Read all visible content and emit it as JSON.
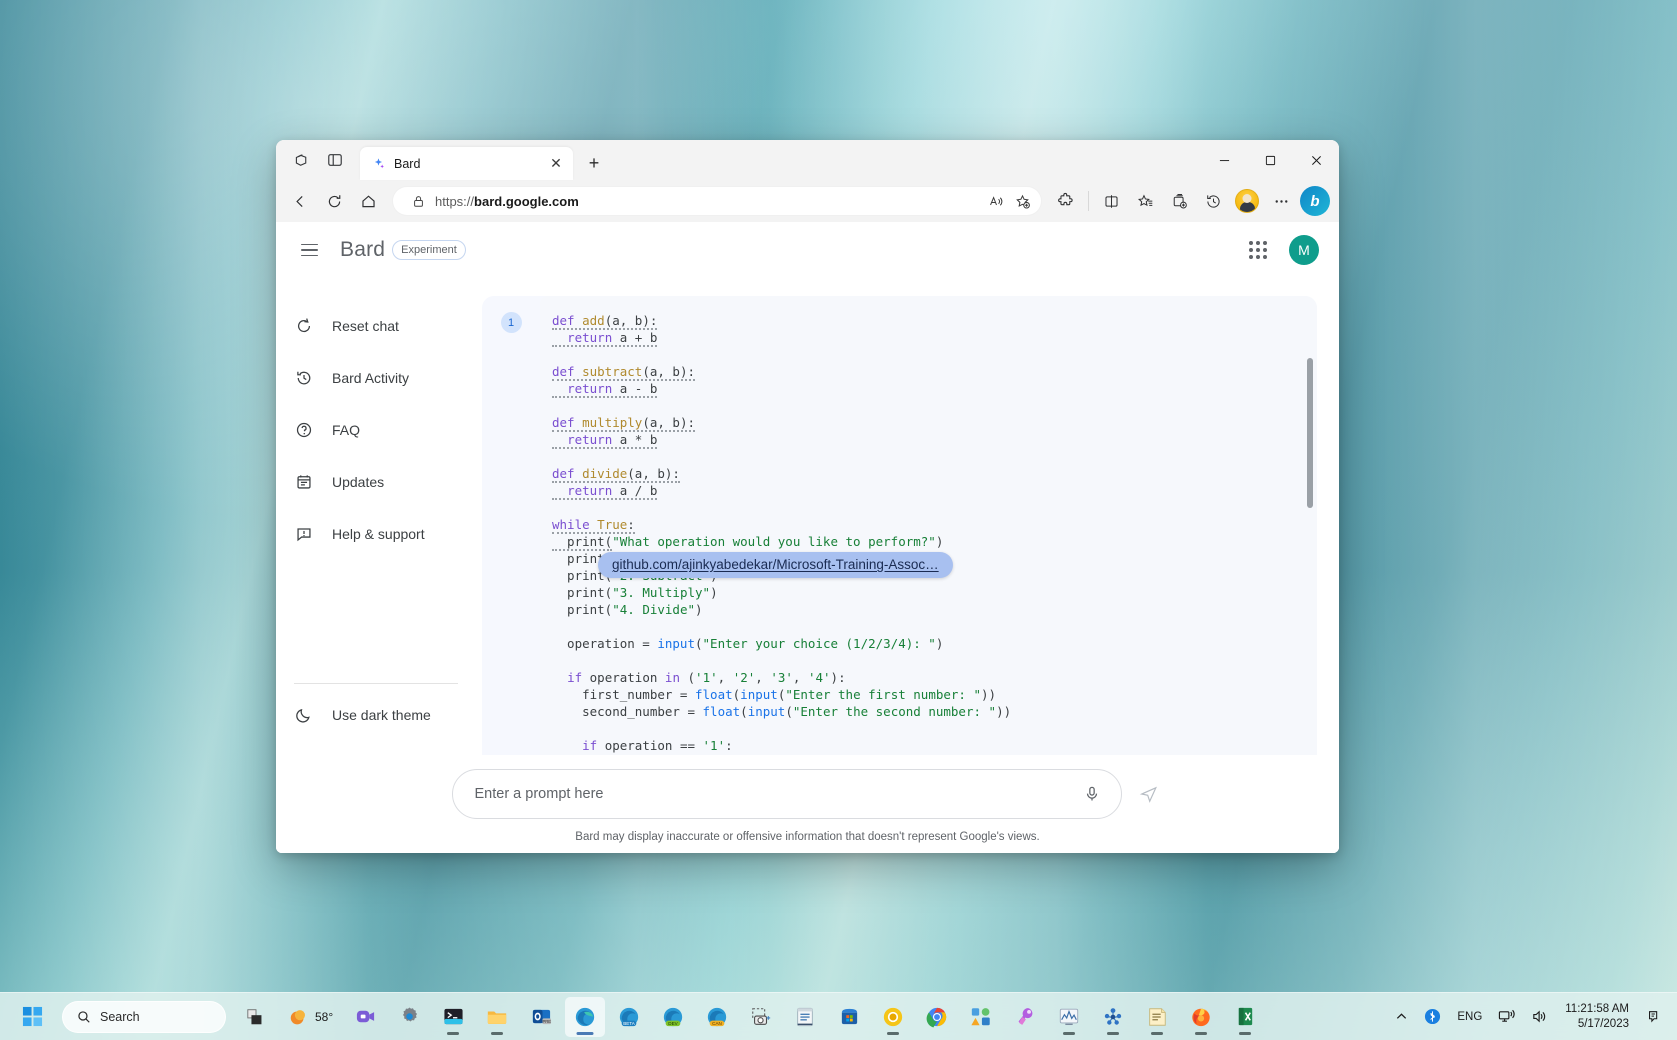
{
  "browser": {
    "tab": {
      "title": "Bard",
      "favicon": "bard-sparkle-icon",
      "close_label": "✕"
    },
    "newtab_label": "+",
    "toolbar": {
      "back": "back-arrow-icon",
      "refresh": "refresh-icon",
      "home": "home-icon",
      "lock": "lock-icon",
      "url_prefix": "https://",
      "url_domain": "bard.google.com",
      "read_aloud": "read-aloud-icon",
      "favorites_add": "add-favorite-icon",
      "extensions": "extensions-icon",
      "split_screen": "split-screen-icon",
      "favorites": "favorites-icon",
      "collections": "collections-icon",
      "history": "history-icon",
      "profile": "profile-avatar",
      "settings_more": "more-options-icon",
      "bing_chat": "bing-discover-icon"
    },
    "window_controls": {
      "minimize": "minimize-icon",
      "maximize": "maximize-icon",
      "close": "close-icon"
    }
  },
  "bard": {
    "header": {
      "menu_icon": "hamburger-menu-icon",
      "logo": "Bard",
      "badge": "Experiment",
      "apps_icon": "google-apps-grid-icon",
      "avatar_initial": "M"
    },
    "sidebar": {
      "items": [
        {
          "label": "Reset chat",
          "icon": "reset-icon"
        },
        {
          "label": "Bard Activity",
          "icon": "history-clock-icon"
        },
        {
          "label": "FAQ",
          "icon": "question-circle-icon"
        },
        {
          "label": "Updates",
          "icon": "calendar-updates-icon"
        },
        {
          "label": "Help & support",
          "icon": "feedback-icon"
        }
      ],
      "theme_toggle": {
        "label": "Use dark theme",
        "icon": "moon-icon"
      }
    },
    "answer": {
      "draft_number": "1",
      "code_language": "python",
      "code_lines": [
        "def add(a, b):",
        "  return a + b",
        "",
        "def subtract(a, b):",
        "  return a - b",
        "",
        "def multiply(a, b):",
        "  return a * b",
        "",
        "def divide(a, b):",
        "  return a / b",
        "",
        "while True:",
        "  print(\"What operation would you like to perform?\")",
        "  print(\"1. Add\")",
        "  print(\"2. Subtract\")",
        "  print(\"3. Multiply\")",
        "  print(\"4. Divide\")",
        "",
        "  operation = input(\"Enter your choice (1/2/3/4): \")",
        "",
        "  if operation in ('1', '2', '3', '4'):",
        "    first_number = float(input(\"Enter the first number: \"))",
        "    second_number = float(input(\"Enter the second number: \"))",
        "",
        "    if operation == '1':"
      ],
      "link_overlay": "github.com/ajinkyabedekar/Microsoft-Training-Assoc…"
    },
    "prompt": {
      "placeholder": "Enter a prompt here",
      "mic_icon": "microphone-icon",
      "send_icon": "send-icon"
    },
    "disclaimer": "Bard may display inaccurate or offensive information that doesn't represent Google's views."
  },
  "taskbar": {
    "start_label": "start-button",
    "search_placeholder": "Search",
    "search_icon": "search-icon",
    "weather": {
      "temp": "58°",
      "icon": "weather-sun-icon"
    },
    "apps": [
      "task-view-icon",
      "teams-icon",
      "settings-icon",
      "terminal-icon",
      "file-explorer-icon",
      "outlook-pre-icon",
      "edge-icon",
      "edge-beta-icon",
      "edge-dev-icon",
      "edge-canary-icon",
      "snipping-tool-icon",
      "notepad-icon",
      "microsoft-store-icon",
      "chrome-canary-icon",
      "chrome-icon",
      "powertoys-icon",
      "paint-3d-icon",
      "performance-monitor-icon",
      "cluster-icon",
      "sticky-notes-icon",
      "firefox-icon",
      "excel-icon"
    ],
    "tray": {
      "chevron": "show-hidden-icons",
      "bluetooth": "bluetooth-icon",
      "language": "ENG",
      "network": "network-icon",
      "volume": "volume-icon",
      "time": "11:21:58 AM",
      "date": "5/17/2023",
      "notifications": "notification-icon"
    }
  }
}
